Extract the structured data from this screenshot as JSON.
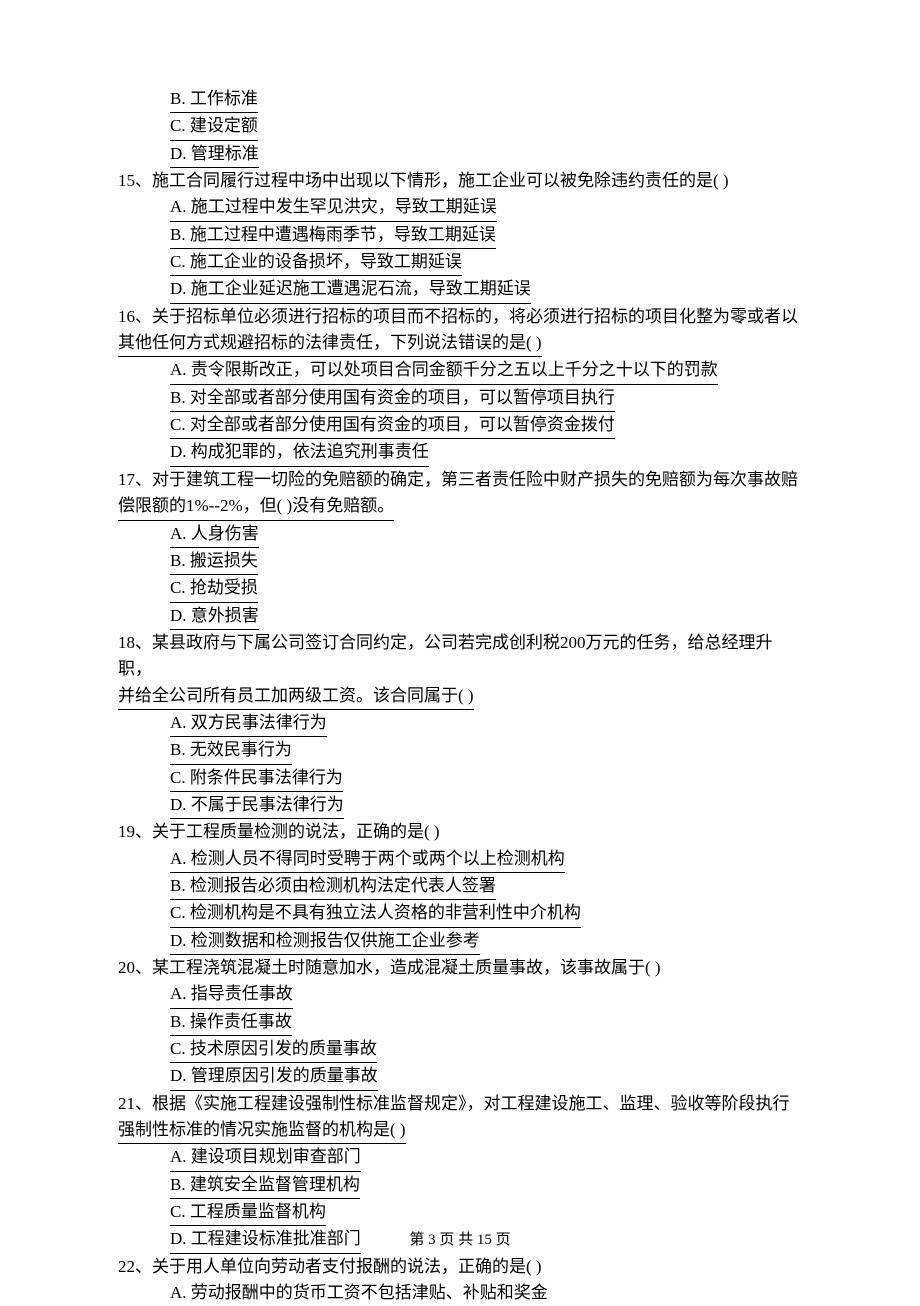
{
  "leading_options": {
    "B": "B. 工作标准",
    "C": "C. 建设定额",
    "D": "D. 管理标准"
  },
  "questions": [
    {
      "num": "15",
      "stem": "15、施工合同履行过程中场中出现以下情形，施工企业可以被免除违约责任的是(    )",
      "options": {
        "A": "A. 施工过程中发生罕见洪灾，导致工期延误",
        "B": "B. 施工过程中遭遇梅雨季节，导致工期延误",
        "C": "C. 施工企业的设备损坏，导致工期延误",
        "D": "D. 施工企业延迟施工遭遇泥石流，导致工期延误"
      }
    },
    {
      "num": "16",
      "stem1": "16、关于招标单位必须进行招标的项目而不招标的，将必须进行招标的项目化整为零或者以",
      "stem2": "其他任何方式规避招标的法律责任，下列说法错误的是(       )",
      "options": {
        "A": "A. 责令限斯改正，可以处项目合同金额千分之五以上千分之十以下的罚款",
        "B": "B. 对全部或者部分使用国有资金的项目，可以暂停项目执行",
        "C": "C. 对全部或者部分使用国有资金的项目，可以暂停资金拨付",
        "D": "D. 构成犯罪的，依法追究刑事责任"
      }
    },
    {
      "num": "17",
      "stem1": "17、对于建筑工程一切险的免赔额的确定，第三者责任险中财产损失的免赔额为每次事故赔",
      "stem2": "偿限额的1%--2%，但(       )没有免赔额。",
      "options": {
        "A": "A. 人身伤害",
        "B": "B. 搬运损失",
        "C": "C. 抢劫受损",
        "D": "D. 意外损害"
      }
    },
    {
      "num": "18",
      "stem1": "18、某县政府与下属公司签订合同约定，公司若完成创利税200万元的任务，给总经理升职，",
      "stem2": "并给全公司所有员工加两级工资。该合同属于(       )",
      "options": {
        "A": "A. 双方民事法律行为",
        "B": "B. 无效民事行为",
        "C": "C. 附条件民事法律行为",
        "D": "D. 不属于民事法律行为"
      }
    },
    {
      "num": "19",
      "stem": "19、关于工程质量检测的说法，正确的是(    )",
      "options": {
        "A": "A. 检测人员不得同时受聘于两个或两个以上检测机构",
        "B": "B. 检测报告必须由检测机构法定代表人签署",
        "C": "C. 检测机构是不具有独立法人资格的非营利性中介机构",
        "D": "D. 检测数据和检测报告仅供施工企业参考"
      }
    },
    {
      "num": "20",
      "stem": "20、某工程浇筑混凝土时随意加水，造成混凝土质量事故，该事故属于(       )",
      "options": {
        "A": "A. 指导责任事故",
        "B": "B. 操作责任事故",
        "C": "C. 技术原因引发的质量事故",
        "D": "D. 管理原因引发的质量事故"
      }
    },
    {
      "num": "21",
      "stem1": "21、根据《实施工程建设强制性标准监督规定》，对工程建设施工、监理、验收等阶段执行",
      "stem2": "强制性标准的情况实施监督的机构是(       )",
      "options": {
        "A": "A. 建设项目规划审查部门",
        "B": "B. 建筑安全监督管理机构",
        "C": "C. 工程质量监督机构",
        "D": "D. 工程建设标准批准部门"
      }
    },
    {
      "num": "22",
      "stem": "22、关于用人单位向劳动者支付报酬的说法，正确的是(       )",
      "options": {
        "A": "A. 劳动报酬中的货币工资不包括津贴、补贴和奖金"
      }
    }
  ],
  "footer": {
    "page_text": "第 3 页 共 15 页"
  }
}
